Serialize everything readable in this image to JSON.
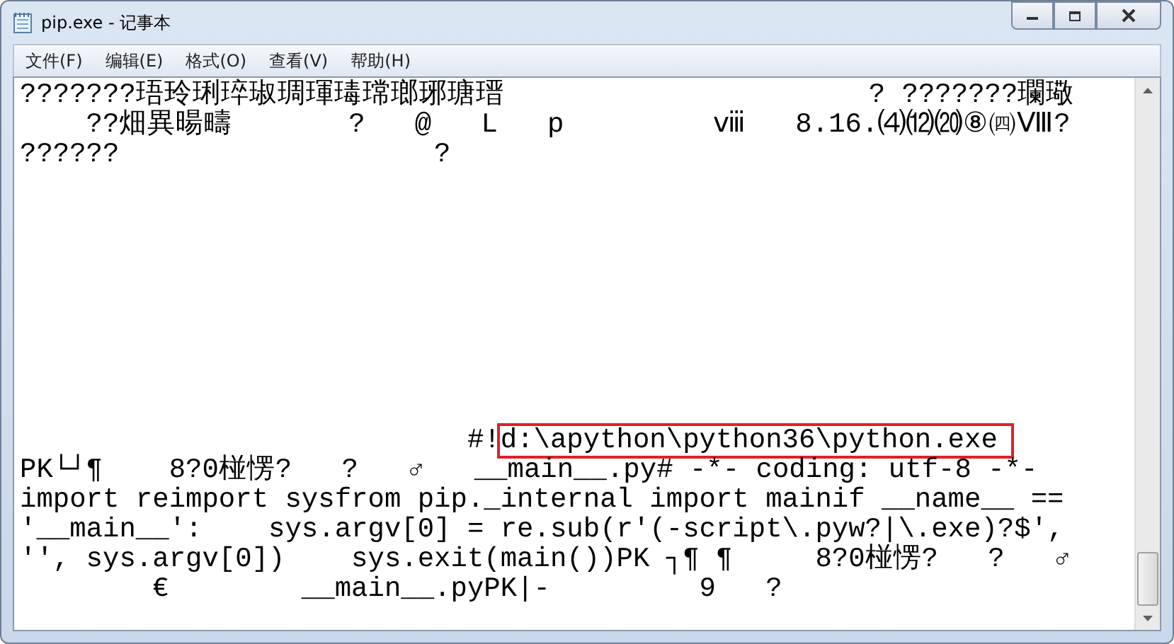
{
  "window": {
    "title": "pip.exe - 记事本"
  },
  "menu": [
    "文件(F)",
    "编辑(E)",
    "格式(O)",
    "查看(V)",
    "帮助(H)"
  ],
  "editor": {
    "top_lines": [
      {
        "text": "???????珸玲琍琗琡琱琿瑇瑺瑯琊瑭瑨                      ? ???????瓓璥"
      },
      {
        "text": "    ??畑異暘疇       ?   @   L   p         ⅷ   8.16.⑷⑿⒇⑧㈣Ⅷ?"
      },
      {
        "text": "??????                   ?"
      }
    ],
    "bottom_lines": [
      {
        "text": "                           #!",
        "highlight": "d:\\apython\\python36\\python.exe"
      },
      {
        "text": "PK└┘¶    8?0椪愣?   ?   ♂   __main__.py# -*- coding: utf-8 -*-"
      },
      {
        "text": "import reimport sysfrom pip._internal import mainif __name__ =="
      },
      {
        "text": "'__main__':    sys.argv[0] = re.sub(r'(-script\\.pyw?|\\.exe)?$',"
      },
      {
        "text": "'', sys.argv[0])    sys.exit(main())PK ┐¶ ¶     8?0椪愣?   ?   ♂"
      },
      {
        "text": "        €        __main__.pyPK|-         9   ?"
      }
    ]
  }
}
